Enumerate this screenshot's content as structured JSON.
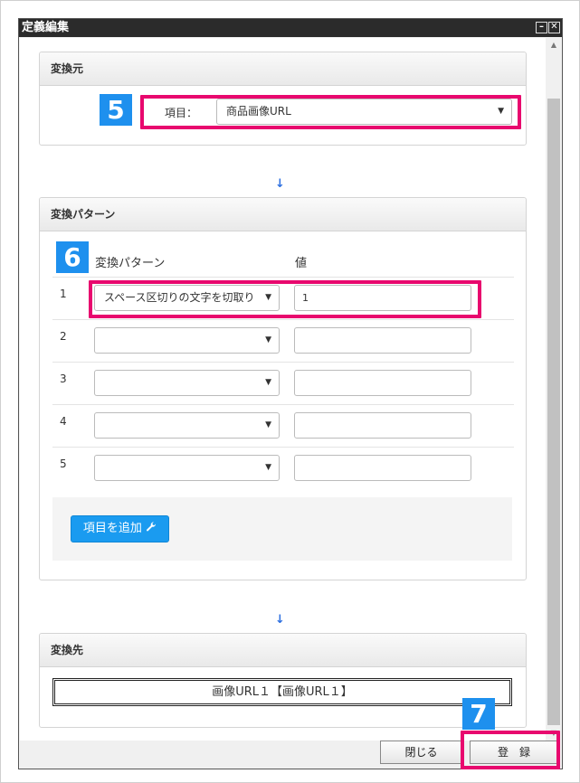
{
  "window": {
    "title": "定義編集",
    "minimize_symbol": "–",
    "close_symbol": "✕"
  },
  "source_panel": {
    "title": "変換元",
    "item_label": "項目：",
    "item_value": "商品画像URL",
    "badge": "5"
  },
  "pattern_panel": {
    "title": "変換パターン",
    "badge": "6",
    "col_pattern": "変換パターン",
    "col_value": "値",
    "rows": [
      {
        "num": "1",
        "pattern": "スペース区切りの文字を切取り",
        "value": "1"
      },
      {
        "num": "2",
        "pattern": "",
        "value": ""
      },
      {
        "num": "3",
        "pattern": "",
        "value": ""
      },
      {
        "num": "4",
        "pattern": "",
        "value": ""
      },
      {
        "num": "5",
        "pattern": "",
        "value": ""
      }
    ],
    "add_button": "項目を追加"
  },
  "dest_panel": {
    "title": "変換先",
    "value": "画像URL１【画像URL１】"
  },
  "footer": {
    "close_button": "閉じる",
    "register_button": "登　録",
    "badge": "7"
  },
  "colors": {
    "highlight": "#e8086e",
    "badge": "#1e90ee",
    "add_button": "#1a9bf0",
    "arrow": "#2d6fe0"
  },
  "icons": {
    "arrow": "arrow-down-icon",
    "caret": "caret-down-icon",
    "wrench": "wrench-icon"
  }
}
